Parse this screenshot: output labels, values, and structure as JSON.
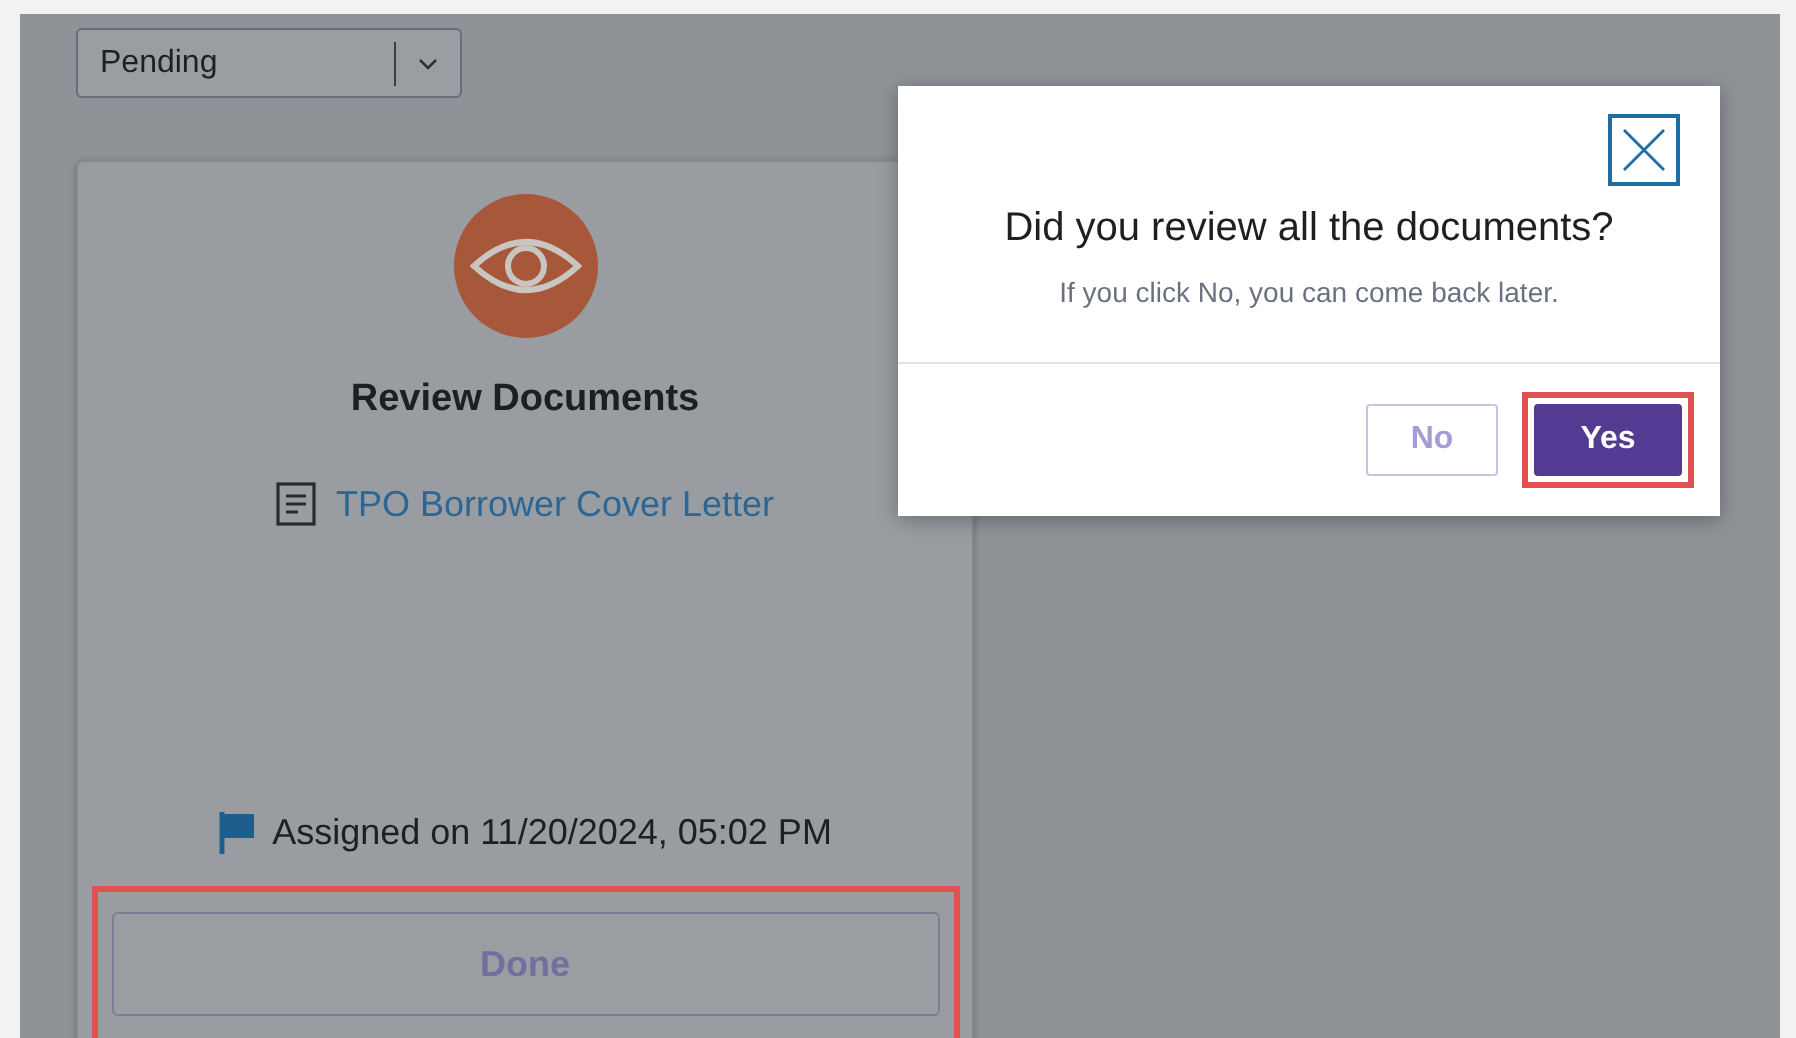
{
  "status_dropdown": {
    "value": "Pending"
  },
  "task_card": {
    "title": "Review Documents",
    "document_link": "TPO Borrower Cover Letter",
    "assigned": "Assigned on 11/20/2024, 05:02 PM",
    "done_button": {
      "label": "Done",
      "disabled": true,
      "highlighted": true
    }
  },
  "dialog": {
    "title": "Did you review all the documents?",
    "message": "If you click No, you can come back later.",
    "buttons": [
      {
        "label": "No",
        "kind": "secondary",
        "highlighted": false
      },
      {
        "label": "Yes",
        "kind": "primary",
        "highlighted": true
      }
    ]
  }
}
